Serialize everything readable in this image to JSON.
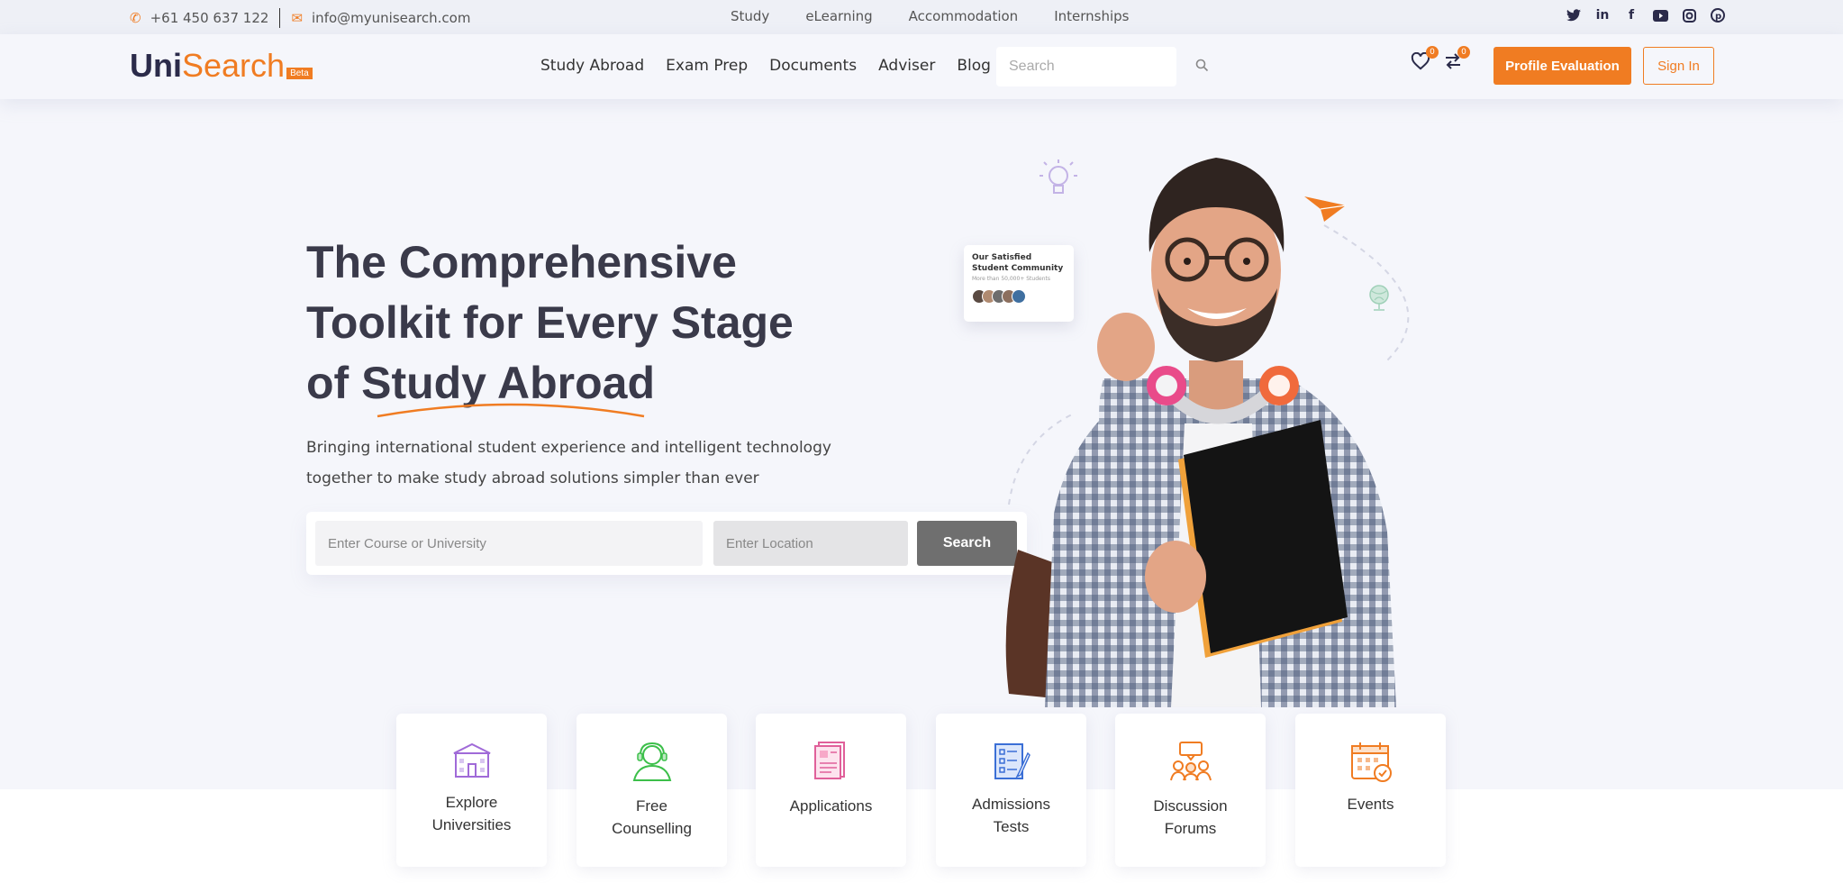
{
  "topbar": {
    "phone": "+61 450 637 122",
    "email": "info@myunisearch.com",
    "links": [
      "Study",
      "eLearning",
      "Accommodation",
      "Internships"
    ],
    "social": [
      "twitter-icon",
      "linkedin-icon",
      "facebook-icon",
      "youtube-icon",
      "instagram-icon",
      "pinterest-icon"
    ]
  },
  "nav": {
    "logo_uni": "Uni",
    "logo_search": "Search",
    "logo_beta": "Beta",
    "items": [
      "Study Abroad",
      "Exam Prep",
      "Documents",
      "Adviser",
      "Blog"
    ],
    "search_placeholder": "Search",
    "wishlist_count": "0",
    "compare_count": "0",
    "profile_button": "Profile Evaluation",
    "signin_button": "Sign In"
  },
  "hero": {
    "title_line1": "The Comprehensive",
    "title_line2": "Toolkit for Every Stage",
    "title_line3_prefix": "of ",
    "title_highlight": "Study Abroad",
    "desc_line1": "Bringing international student experience and intelligent technology",
    "desc_line2": "together to make study abroad solutions simpler than ever",
    "course_placeholder": "Enter Course or University",
    "location_placeholder": "Enter Location",
    "search_button": "Search"
  },
  "community": {
    "title": "Our Satisfied Student Community",
    "subtitle": "More than 50,000+ Students"
  },
  "features": [
    {
      "line1": "Explore",
      "line2": "Universities",
      "icon": "university-icon",
      "color": "#a06ad8"
    },
    {
      "line1": "Free",
      "line2": "Counselling",
      "icon": "counsellor-icon",
      "color": "#3cbf4a"
    },
    {
      "line1": "Applications",
      "line2": "",
      "icon": "application-icon",
      "color": "#e0609a"
    },
    {
      "line1": "Admissions",
      "line2": "Tests",
      "icon": "test-icon",
      "color": "#3b6fd6"
    },
    {
      "line1": "Discussion",
      "line2": "Forums",
      "icon": "forum-icon",
      "color": "#f07c22"
    },
    {
      "line1": "Events",
      "line2": "",
      "icon": "calendar-icon",
      "color": "#f07c22"
    }
  ],
  "colors": {
    "accent": "#f07c22",
    "dark": "#2b2b4a",
    "background": "#f5f6fb"
  }
}
